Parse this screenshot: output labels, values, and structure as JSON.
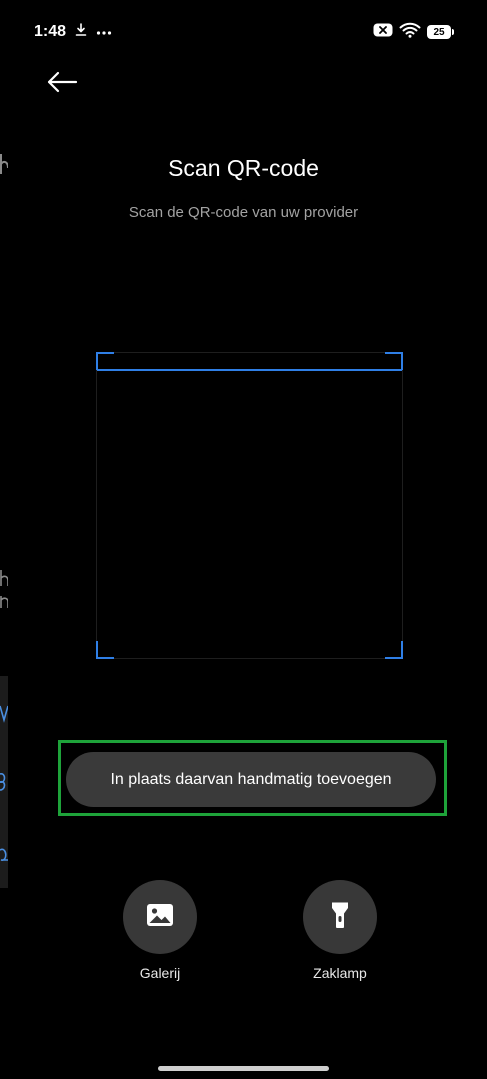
{
  "status_bar": {
    "time": "1:48",
    "battery_level": "25",
    "icons": [
      "download-icon",
      "more-dots-icon",
      "close-notification-icon",
      "wifi-icon",
      "battery-icon"
    ]
  },
  "header": {
    "back_icon": "arrow-left-icon"
  },
  "main": {
    "title": "Scan QR-code",
    "subtitle": "Scan de QR-code van uw provider",
    "manual_add_label": "In plaats daarvan handmatig toevoegen"
  },
  "actions": {
    "gallery": {
      "label": "Galerij",
      "icon": "image-icon"
    },
    "flashlight": {
      "label": "Zaklamp",
      "icon": "flashlight-icon"
    }
  },
  "colors": {
    "background": "#000000",
    "accent_blue": "#2f7fe6",
    "highlight_green": "#1ea33a",
    "button_gray": "#3a3a3a"
  }
}
